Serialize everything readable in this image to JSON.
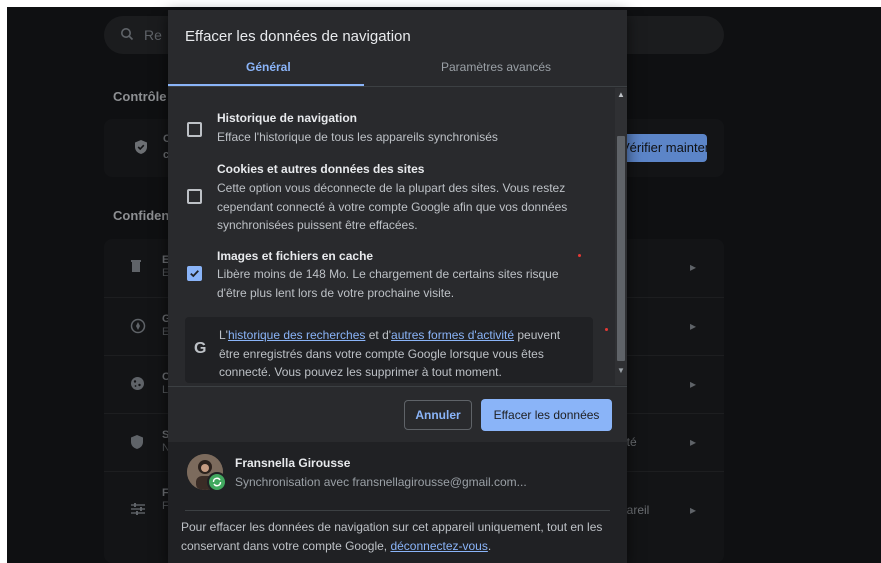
{
  "background": {
    "search_placeholder": "Re",
    "heading_control": "Contrôle d",
    "heading_confidentiality": "Confident",
    "safety_card_letters": [
      "C",
      "c"
    ],
    "check_now_button": "Vérifier maintenant",
    "rows": [
      {
        "icon": "trash-icon",
        "letter1": "E",
        "letter2": "E",
        "right_text": ""
      },
      {
        "icon": "compass-icon",
        "letter1": "G",
        "letter2": "E",
        "right_text": ""
      },
      {
        "icon": "cookie-icon",
        "letter1": "C",
        "letter2": "L",
        "right_text": ""
      },
      {
        "icon": "shield-icon",
        "letter1": "S",
        "letter2": "N",
        "right_text": "rité"
      },
      {
        "icon": "sliders-icon",
        "letter1": "F",
        "letter2": "F",
        "right_text": "pareil"
      }
    ]
  },
  "dialog": {
    "title": "Effacer les données de navigation",
    "tabs": {
      "general": "Général",
      "advanced": "Paramètres avancés"
    },
    "items": [
      {
        "title": "Historique de navigation",
        "description": "Efface l'historique de tous les appareils synchronisés",
        "checked": false
      },
      {
        "title": "Cookies et autres données des sites",
        "description": "Cette option vous déconnecte de la plupart des sites. Vous restez cependant connecté à votre compte Google afin que vos données synchronisées puissent être effacées.",
        "checked": false
      },
      {
        "title": "Images et fichiers en cache",
        "description": "Libère moins de 148 Mo. Le chargement de certains sites risque d'être plus lent lors de votre prochaine visite.",
        "checked": true
      }
    ],
    "google_info": {
      "prefix": "L'",
      "link1": "historique des recherches",
      "mid": " et d'",
      "link2": "autres formes d'activité",
      "suffix": " peuvent être enregistrés dans votre compte Google lorsque vous êtes connecté. Vous pouvez les supprimer à tout moment.",
      "icon_letter": "G"
    },
    "buttons": {
      "cancel": "Annuler",
      "clear": "Effacer les données"
    },
    "account": {
      "name": "Fransnella Girousse",
      "sync": "Synchronisation avec fransnellagirousse@gmail.com...",
      "note_prefix": "Pour effacer les données de navigation sur cet appareil uniquement, tout en les conservant dans votre compte Google, ",
      "note_link": "déconnectez-vous",
      "note_suffix": "."
    }
  }
}
